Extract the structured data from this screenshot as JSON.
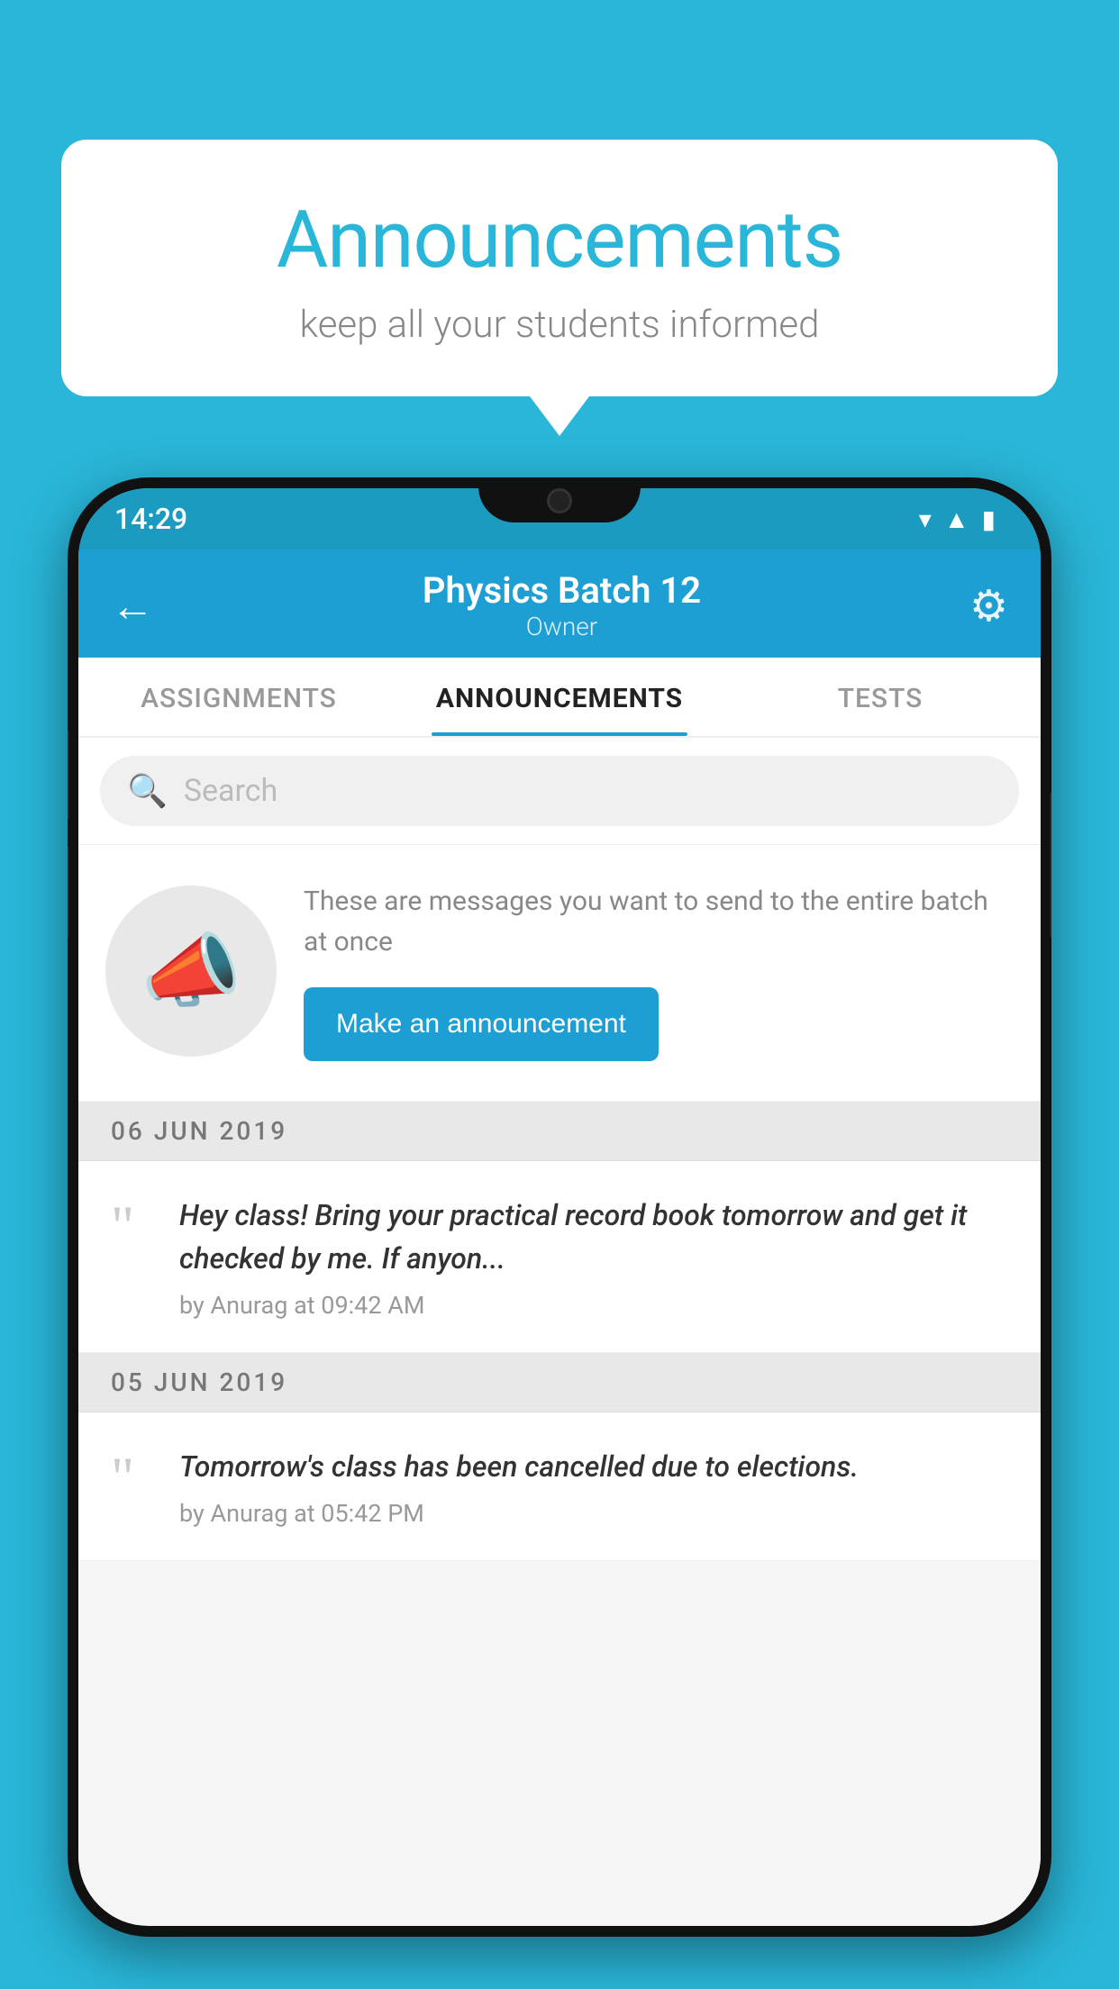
{
  "background_color": "#29b6d8",
  "speech_bubble": {
    "title": "Announcements",
    "subtitle": "keep all your students informed"
  },
  "status_bar": {
    "time": "14:29",
    "icons": [
      "wifi",
      "signal",
      "battery"
    ]
  },
  "header": {
    "title": "Physics Batch 12",
    "subtitle": "Owner",
    "back_label": "←",
    "gear_label": "⚙"
  },
  "tabs": [
    {
      "label": "ASSIGNMENTS",
      "active": false
    },
    {
      "label": "ANNOUNCEMENTS",
      "active": true
    },
    {
      "label": "TESTS",
      "active": false
    }
  ],
  "search": {
    "placeholder": "Search"
  },
  "promo": {
    "description": "These are messages you want to send to the entire batch at once",
    "button_label": "Make an announcement"
  },
  "date_groups": [
    {
      "date": "06  JUN  2019",
      "announcements": [
        {
          "text": "Hey class! Bring your practical record book tomorrow and get it checked by me. If anyon...",
          "meta": "by Anurag at 09:42 AM"
        }
      ]
    },
    {
      "date": "05  JUN  2019",
      "announcements": [
        {
          "text": "Tomorrow's class has been cancelled due to elections.",
          "meta": "by Anurag at 05:42 PM"
        }
      ]
    }
  ]
}
